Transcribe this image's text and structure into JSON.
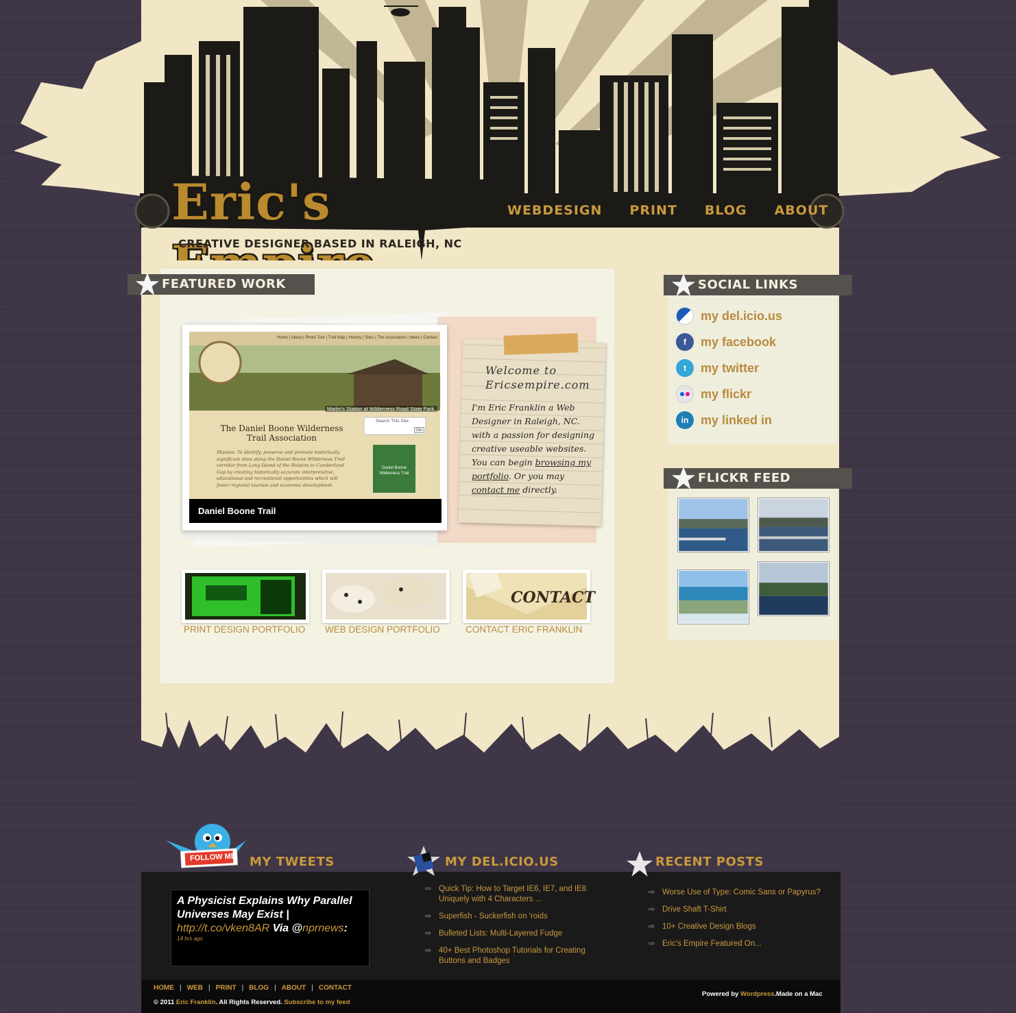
{
  "site": {
    "logo": "Eric's Empire",
    "tagline": "CREATIVE DESIGNER BASED IN RALEIGH, NC"
  },
  "nav": [
    "WEBDESIGN",
    "PRINT",
    "BLOG",
    "ABOUT"
  ],
  "featured": {
    "title": "FEATURED WORK",
    "slide": {
      "caption": "Daniel Boone Trail",
      "screenshot_nav": "Home | About | Photo Tour | Trail Map | History | Sites | The Association | News | Contact",
      "screenshot_photo_caption": "Martin's Station at Wilderness Road State Park.",
      "screenshot_heading": "The Daniel Boone Wilderness Trail Association",
      "screenshot_search_label": "Search This Site:",
      "screenshot_search_button": "Go",
      "screenshot_badge": "Daniel Boone Wilderness Trail",
      "screenshot_mission": "Mission: To identify, preserve and promote historically significant sites along the Daniel Boone Wilderness Trail corridor from Long Island of the Holston to Cumberland Gap by creating historically accurate interpretative, educational and recreational opportunities which will foster regional tourism and economic development."
    },
    "note": {
      "title_line1": "Welcome to",
      "title_line2": "Ericsempire.com",
      "body_prefix": "I'm Eric Franklin a Web Designer in Raleigh, NC. with a passion for designing creative useable websites. You can begin",
      "link1": "browsing my portfolio",
      "body_middle": ". Or you may",
      "link2": "contact me",
      "body_suffix": "directly."
    },
    "thumbs": [
      {
        "label": "PRINT DESIGN PORTFOLIO"
      },
      {
        "label": "WEB DESIGN PORTFOLIO"
      },
      {
        "label": "CONTACT ERIC FRANKLIN",
        "overlay": "CONTACT"
      }
    ]
  },
  "social": {
    "title": "SOCIAL LINKS",
    "items": [
      {
        "label": "my del.icio.us",
        "icon": "delicious-icon",
        "color": "#1b5cb8"
      },
      {
        "label": "my facebook",
        "icon": "facebook-icon",
        "color": "#3b5998"
      },
      {
        "label": "my twitter",
        "icon": "twitter-icon",
        "color": "#33a7d8"
      },
      {
        "label": "my flickr",
        "icon": "flickr-icon",
        "color": "#e6e6ea"
      },
      {
        "label": "my linked in",
        "icon": "linkedin-icon",
        "color": "#1d7fb5"
      }
    ]
  },
  "flickr": {
    "title": "FLICKR FEED"
  },
  "tweets": {
    "badge": "FOLLOW ME",
    "title": "MY TWEETS",
    "text_main": "A Physicist Explains Why Parallel Universes May Exist |",
    "link": "http://t.co/vken8AR",
    "via": "Via @",
    "handle": "nprnews",
    "colon": ":",
    "time": "14 hrs ago"
  },
  "delicious": {
    "title": "MY DEL.ICIO.US",
    "items": [
      "Quick Tip: How to Target IE6, IE7, and IE8 Uniquely with 4 Characters ...",
      "Superfish - Suckerfish on 'roids",
      "Bulleted Lists: Multi-Layered Fudge",
      "40+ Best Photoshop Tutorials for Creating Buttons and Badges"
    ]
  },
  "recent": {
    "title": "RECENT POSTS",
    "items": [
      "Worse Use of Type: Comic Sans or Papyrus?",
      "Drive Shaft T-Shirt",
      "10+ Creative Design Blogs",
      "Eric's Empire Featured On..."
    ]
  },
  "footer": {
    "links": [
      "HOME",
      "WEB",
      "PRINT",
      "BLOG",
      "ABOUT",
      "CONTACT"
    ],
    "copyright_prefix": "© 2011",
    "copyright_name": "Eric Franklin",
    "copyright_rights": ". All Rights Reserved.",
    "subscribe": "Subscribe to my feed",
    "powered_prefix": "Powered by",
    "powered_link": "Wordpress",
    "powered_suffix": ".Made on a Mac"
  },
  "colors": {
    "background": "#3f3647",
    "paper": "#f1e6c6",
    "accent": "#c99a3c",
    "dark": "#1b1a1b"
  }
}
